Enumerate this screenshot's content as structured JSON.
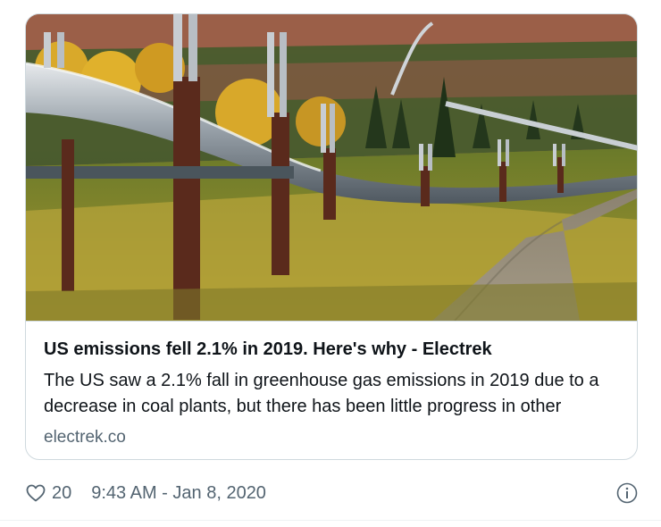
{
  "card": {
    "title": "US emissions fell 2.1% in 2019. Here's why - Electrek",
    "description": "The US saw a 2.1% fall in greenhouse gas emissions in 2019 due to a decrease in coal plants, but there has been little progress in other",
    "domain": "electrek.co",
    "image_icon": "pipeline-photo"
  },
  "tweet_meta": {
    "like_icon": "heart-icon",
    "like_count": "20",
    "timestamp": "9:43 AM - Jan 8, 2020",
    "info_icon": "info-icon"
  },
  "colors": {
    "text_primary": "#0f1419",
    "text_secondary": "#536471",
    "border": "#cfd9de"
  }
}
